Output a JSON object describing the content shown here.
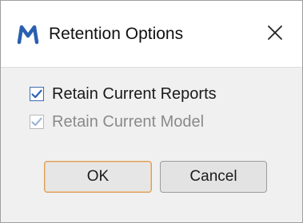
{
  "window": {
    "title": "Retention Options",
    "app_icon": "m-logo-icon",
    "close_icon": "close-icon"
  },
  "options": [
    {
      "label": "Retain Current Reports",
      "checked": true,
      "enabled": true
    },
    {
      "label": "Retain Current Model",
      "checked": true,
      "enabled": false
    }
  ],
  "buttons": {
    "ok_label": "OK",
    "cancel_label": "Cancel"
  },
  "colors": {
    "accent": "#2a5fb0",
    "disabled_check": "#9bb4d6",
    "default_button_border": "#d89f5b"
  }
}
